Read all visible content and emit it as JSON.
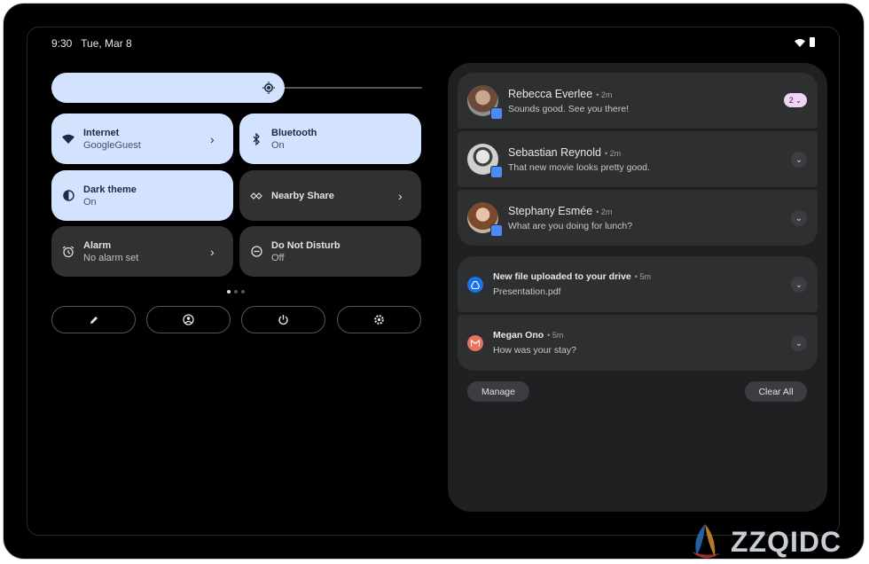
{
  "status": {
    "time": "9:30",
    "date": "Tue, Mar 8"
  },
  "brightness": {
    "level": 0.6
  },
  "tiles": [
    {
      "title": "Internet",
      "sub": "GoogleGuest",
      "state": "on",
      "icon": "wifi-icon",
      "chevron": true
    },
    {
      "title": "Bluetooth",
      "sub": "On",
      "state": "on",
      "icon": "bluetooth-icon",
      "chevron": false
    },
    {
      "title": "Dark theme",
      "sub": "On",
      "state": "on",
      "icon": "dark-theme-icon",
      "chevron": false
    },
    {
      "title": "Nearby Share",
      "sub": "",
      "state": "off",
      "icon": "nearby-share-icon",
      "chevron": true
    },
    {
      "title": "Alarm",
      "sub": "No alarm set",
      "state": "off",
      "icon": "alarm-icon",
      "chevron": true
    },
    {
      "title": "Do Not Disturb",
      "sub": "Off",
      "state": "off",
      "icon": "do-not-disturb-icon",
      "chevron": false
    }
  ],
  "page_dots": {
    "count": 3,
    "active": 0
  },
  "bottom_buttons": [
    "edit-icon",
    "user-icon",
    "power-icon",
    "settings-icon"
  ],
  "conversations": [
    {
      "name": "Rebecca Everlee",
      "time": "2m",
      "message": "Sounds good. See you there!",
      "count": "2"
    },
    {
      "name": "Sebastian Reynold",
      "time": "2m",
      "message": "That new movie looks pretty good."
    },
    {
      "name": "Stephany Esmée",
      "time": "2m",
      "message": "What are you doing for lunch?"
    }
  ],
  "notifications": [
    {
      "title": "New file uploaded to your drive",
      "time": "5m",
      "message": "Presentation.pdf",
      "icon": "drive-icon",
      "color": "#1a73e8"
    },
    {
      "title": "Megan Ono",
      "time": "5m",
      "message": "How was your stay?",
      "icon": "gmail-icon",
      "color": "#e8715f"
    }
  ],
  "actions": {
    "manage": "Manage",
    "clear_all": "Clear All"
  },
  "watermark": {
    "text": "ZZQIDC"
  },
  "colors": {
    "tile_on": "#d3e3fd",
    "tile_off": "#2f3133",
    "panel": "#1f2021",
    "card": "#2d2f31"
  }
}
